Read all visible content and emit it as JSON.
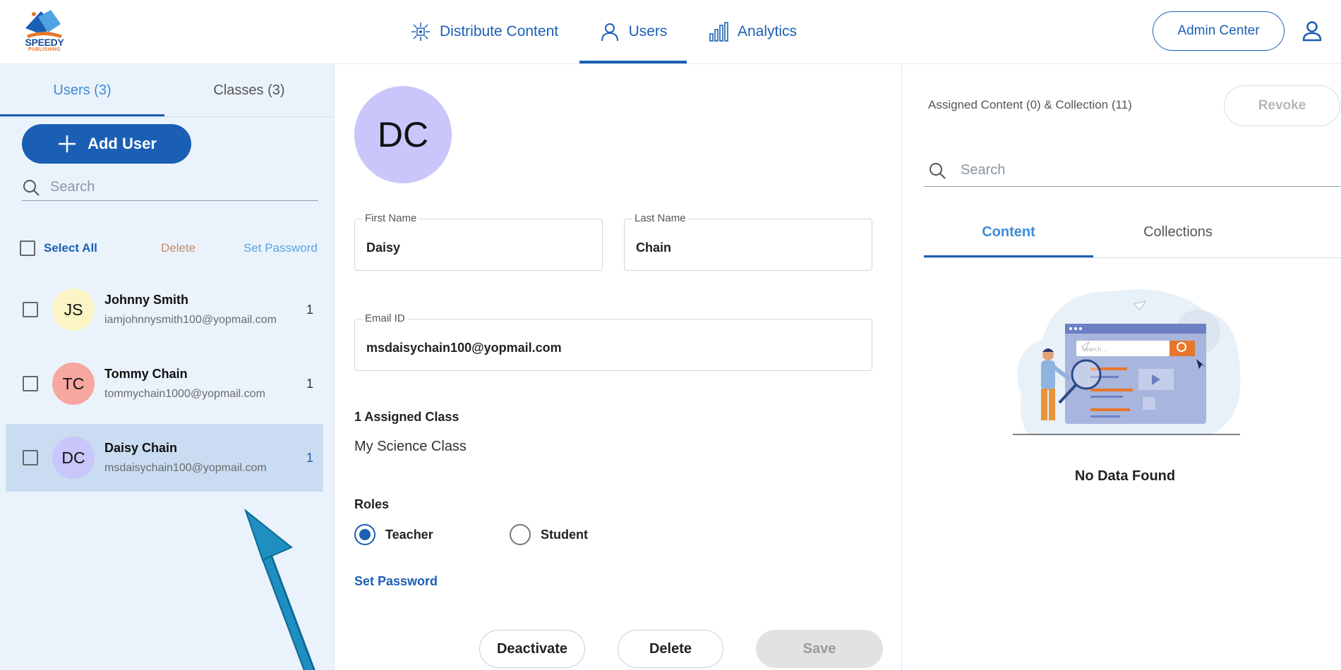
{
  "brand": {
    "name": "SPEEDY",
    "sub": "PUBLISHING"
  },
  "nav": {
    "tabs": [
      {
        "label": "Distribute Content",
        "icon": "distribute-icon"
      },
      {
        "label": "Users",
        "icon": "user-icon"
      },
      {
        "label": "Analytics",
        "icon": "analytics-icon"
      }
    ],
    "active_tab": "Users",
    "admin_center": "Admin Center"
  },
  "left": {
    "tabs": [
      {
        "label": "Users (3)"
      },
      {
        "label": "Classes (3)"
      }
    ],
    "add_user": "Add User",
    "search_placeholder": "Search",
    "select_all": "Select All",
    "delete": "Delete",
    "set_password": "Set Password",
    "users": [
      {
        "initials": "JS",
        "name": "Johnny Smith",
        "email": "iamjohnnysmith100@yopmail.com",
        "count": "1",
        "color": "#fbf5c5"
      },
      {
        "initials": "TC",
        "name": "Tommy Chain",
        "email": "tommychain1000@yopmail.com",
        "count": "1",
        "color": "#f7a6a0"
      },
      {
        "initials": "DC",
        "name": "Daisy Chain",
        "email": "msdaisychain100@yopmail.com",
        "count": "1",
        "color": "#c8c6fa"
      }
    ],
    "selected_user": "Daisy Chain"
  },
  "detail": {
    "avatar_initials": "DC",
    "avatar_color": "#c8c6fa",
    "first_name_label": "First Name",
    "first_name": "Daisy",
    "last_name_label": "Last Name",
    "last_name": "Chain",
    "email_label": "Email ID",
    "email": "msdaisychain100@yopmail.com",
    "assigned_class_title": "1 Assigned Class",
    "assigned_class": "My Science Class",
    "roles_title": "Roles",
    "roles": [
      {
        "label": "Teacher",
        "selected": true
      },
      {
        "label": "Student",
        "selected": false
      }
    ],
    "set_password": "Set Password",
    "buttons": {
      "deactivate": "Deactivate",
      "delete": "Delete",
      "save": "Save"
    }
  },
  "right": {
    "assigned_title": "Assigned Content (0) & Collection (11)",
    "revoke": "Revoke",
    "search_placeholder": "Search",
    "tabs": [
      {
        "label": "Content"
      },
      {
        "label": "Collections"
      }
    ],
    "active_tab": "Content",
    "illustration_search_text": "Search...",
    "empty_message": "No Data Found"
  },
  "colors": {
    "primary": "#1b5fb5",
    "accent": "#3f8bd6",
    "left_bg": "#eaf3fc",
    "selected_row": "#c9dcf2",
    "annotation_arrow": "#1e8fc0"
  }
}
